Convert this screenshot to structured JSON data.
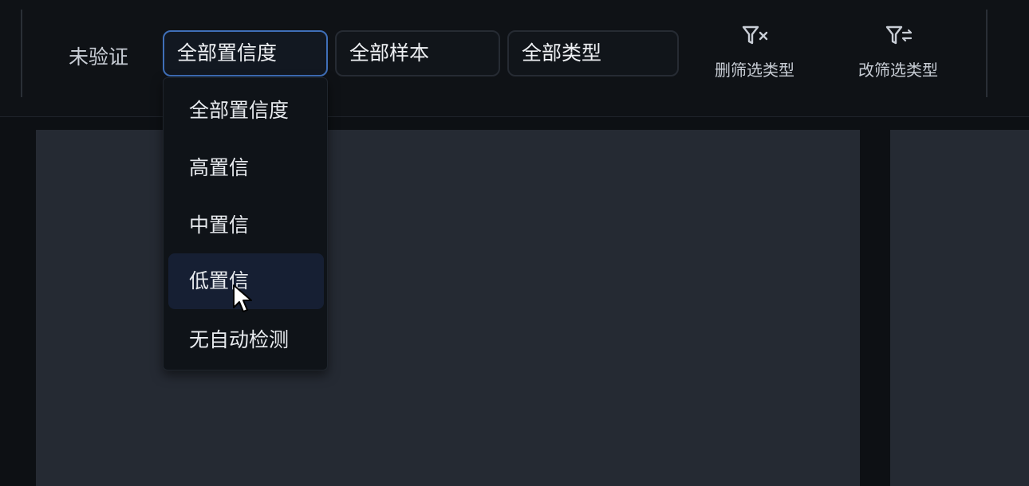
{
  "toolbar": {
    "status_label": "未验证",
    "selects": {
      "confidence": "全部置信度",
      "sample": "全部样本",
      "type": "全部类型"
    },
    "buttons": {
      "delete_filter_type": {
        "label": "删筛选类型",
        "icon": "filter-x-icon"
      },
      "change_filter_type": {
        "label": "改筛选类型",
        "icon": "filter-swap-icon"
      }
    }
  },
  "confidence_dropdown": {
    "items": [
      "全部置信度",
      "高置信",
      "中置信",
      "低置信",
      "无自动检测"
    ],
    "hovered_index": 3
  },
  "colors": {
    "background": "#0d1014",
    "panel": "#252a33",
    "accent_border": "#3f6fb8",
    "hover_item": "#161f33"
  }
}
